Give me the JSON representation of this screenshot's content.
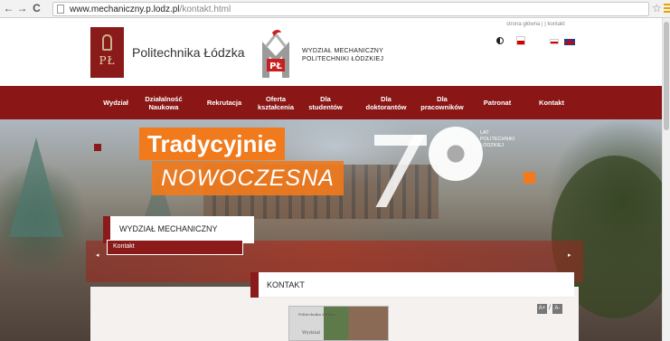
{
  "browser": {
    "back_glyph": "←",
    "forward_glyph": "→",
    "reload_glyph": "C",
    "url_host": "www.mechaniczny.p.lodz.pl",
    "url_path": "/kontakt.html",
    "star_glyph": "☆"
  },
  "header": {
    "pl_name": "Politechnika Łódzka",
    "pl_emblem_text": "PŁ",
    "wm_name": "WYDZIAŁ MECHANICZNY\nPOLITECHNIKI ŁÓDZKIEJ",
    "top_links": "strona główna  |  |  kontakt"
  },
  "nav": {
    "items": [
      {
        "label": "Wydział"
      },
      {
        "label": "Działalność\nNaukowa"
      },
      {
        "label": "Rekrutacja"
      },
      {
        "label": "Oferta\nkształcenia"
      },
      {
        "label": "Dla\nstudentów"
      },
      {
        "label": "Dla\ndoktorantów"
      },
      {
        "label": "Dla\npracowników"
      },
      {
        "label": "Patronat"
      },
      {
        "label": "Kontakt"
      }
    ]
  },
  "banner": {
    "headline": "Tradycyjnie",
    "subheadline": "NOWOCZESNA",
    "anniversary_text": "LAT\nPOLITECHNIKI\nŁÓDZKIEJ",
    "arrow_left": "◂",
    "arrow_right": "▸"
  },
  "section": {
    "title": "WYDZIAŁ MECHANICZNY",
    "breadcrumb": "Kontakt"
  },
  "content": {
    "title": "KONTAKT",
    "font_increase": "A+",
    "font_separator": "/",
    "font_decrease": "A-",
    "photo_sign_1": "Politechnika Łódzka",
    "photo_sign_2": "Wydział"
  },
  "colors": {
    "brand_red": "#8a1616",
    "accent_orange": "#f07a1c"
  }
}
